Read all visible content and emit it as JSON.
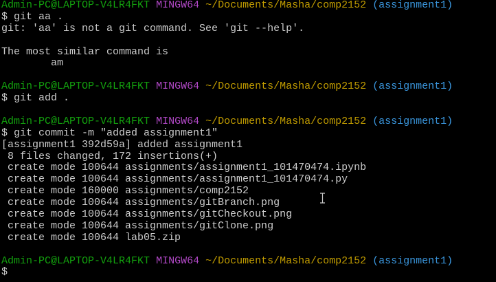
{
  "prompt": {
    "user_host": "Admin-PC@LAPTOP-V4LR4FKT",
    "system": "MINGW64",
    "path": "~/Documents/Masha/comp2152",
    "branch": "(assignment1)"
  },
  "colors": {
    "user_host": "#13a10e",
    "system": "#b148c6",
    "path": "#c19c00",
    "branch": "#3a96dd",
    "text": "#cccccc",
    "background": "#000000"
  },
  "lines": [
    {
      "type": "prompt"
    },
    {
      "type": "text",
      "text": "$ git aa ."
    },
    {
      "type": "text",
      "text": "git: 'aa' is not a git command. See 'git --help'."
    },
    {
      "type": "text",
      "text": ""
    },
    {
      "type": "text",
      "text": "The most similar command is"
    },
    {
      "type": "text",
      "text": "        am"
    },
    {
      "type": "text",
      "text": ""
    },
    {
      "type": "prompt"
    },
    {
      "type": "text",
      "text": "$ git add ."
    },
    {
      "type": "text",
      "text": ""
    },
    {
      "type": "prompt"
    },
    {
      "type": "text",
      "text": "$ git commit -m \"added assignment1\""
    },
    {
      "type": "text",
      "text": "[assignment1 392d59a] added assignment1"
    },
    {
      "type": "text",
      "text": " 8 files changed, 172 insertions(+)"
    },
    {
      "type": "text",
      "text": " create mode 100644 assignments/assignment1_101470474.ipynb"
    },
    {
      "type": "text",
      "text": " create mode 100644 assignments/assignment1_101470474.py"
    },
    {
      "type": "text",
      "text": " create mode 160000 assignments/comp2152"
    },
    {
      "type": "text",
      "text": " create mode 100644 assignments/gitBranch.png"
    },
    {
      "type": "text",
      "text": " create mode 100644 assignments/gitCheckout.png"
    },
    {
      "type": "text",
      "text": " create mode 100644 assignments/gitClone.png"
    },
    {
      "type": "text",
      "text": " create mode 100644 lab05.zip"
    },
    {
      "type": "text",
      "text": ""
    },
    {
      "type": "prompt"
    },
    {
      "type": "text",
      "text": "$ "
    }
  ]
}
